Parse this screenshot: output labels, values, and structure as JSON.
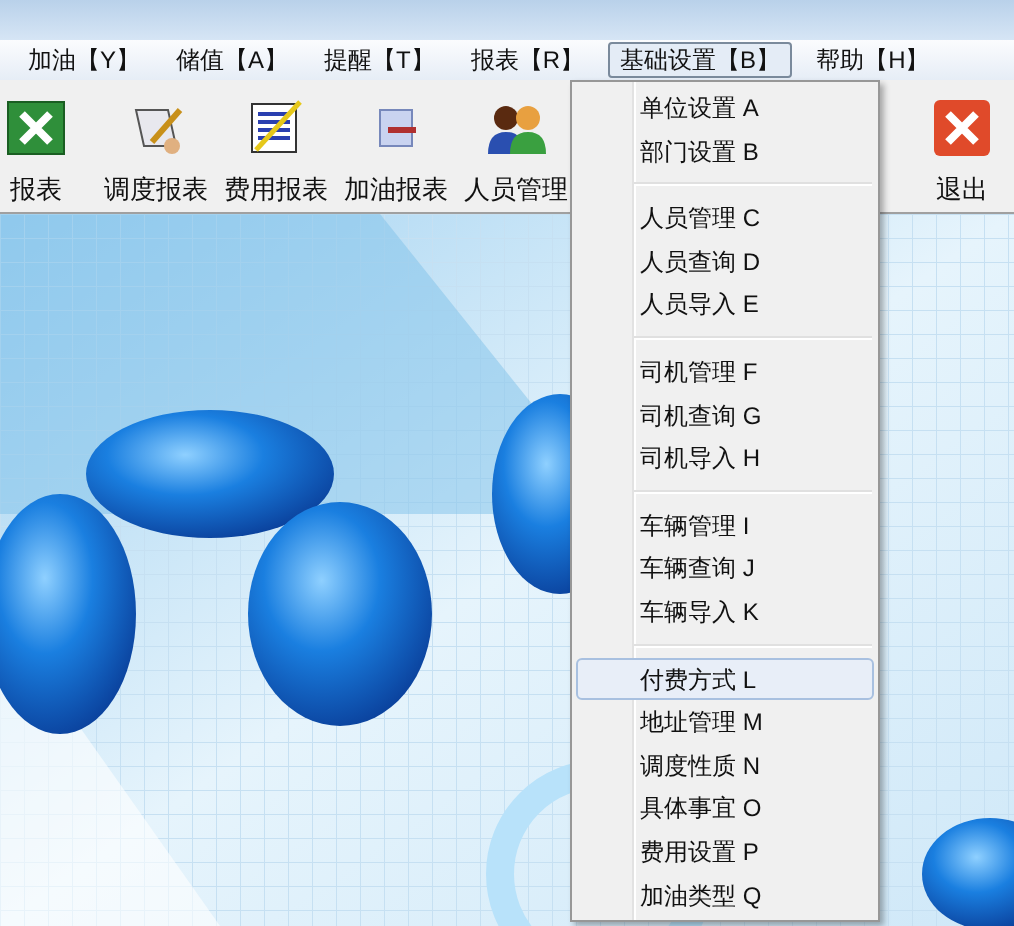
{
  "menu_bar": [
    {
      "label": "加油【Y】",
      "selected": false
    },
    {
      "label": "储值【A】",
      "selected": false
    },
    {
      "label": "提醒【T】",
      "selected": false
    },
    {
      "label": "报表【R】",
      "selected": false
    },
    {
      "label": "基础设置【B】",
      "selected": true
    },
    {
      "label": "帮助【H】",
      "selected": false
    }
  ],
  "toolbar": [
    {
      "label": "报表"
    },
    {
      "label": "调度报表"
    },
    {
      "label": "费用报表"
    },
    {
      "label": "加油报表"
    },
    {
      "label": "人员管理"
    },
    {
      "label": "退出"
    }
  ],
  "dropdown": [
    {
      "kind": "item",
      "label": "单位设置 A",
      "selected": false
    },
    {
      "kind": "item",
      "label": "部门设置 B",
      "selected": false
    },
    {
      "kind": "separator"
    },
    {
      "kind": "item",
      "label": "人员管理 C",
      "selected": false
    },
    {
      "kind": "item",
      "label": "人员查询 D",
      "selected": false
    },
    {
      "kind": "item",
      "label": "人员导入 E",
      "selected": false
    },
    {
      "kind": "separator"
    },
    {
      "kind": "item",
      "label": "司机管理 F",
      "selected": false
    },
    {
      "kind": "item",
      "label": "司机查询 G",
      "selected": false
    },
    {
      "kind": "item",
      "label": "司机导入 H",
      "selected": false
    },
    {
      "kind": "separator"
    },
    {
      "kind": "item",
      "label": "车辆管理 I",
      "selected": false
    },
    {
      "kind": "item",
      "label": "车辆查询 J",
      "selected": false
    },
    {
      "kind": "item",
      "label": "车辆导入 K",
      "selected": false
    },
    {
      "kind": "separator"
    },
    {
      "kind": "item",
      "label": "付费方式 L",
      "selected": true
    },
    {
      "kind": "item",
      "label": "地址管理 M",
      "selected": false
    },
    {
      "kind": "item",
      "label": "调度性质 N",
      "selected": false
    },
    {
      "kind": "item",
      "label": "具体事宜 O",
      "selected": false
    },
    {
      "kind": "item",
      "label": "费用设置 P",
      "selected": false
    },
    {
      "kind": "item",
      "label": "加油类型 Q",
      "selected": false
    }
  ]
}
